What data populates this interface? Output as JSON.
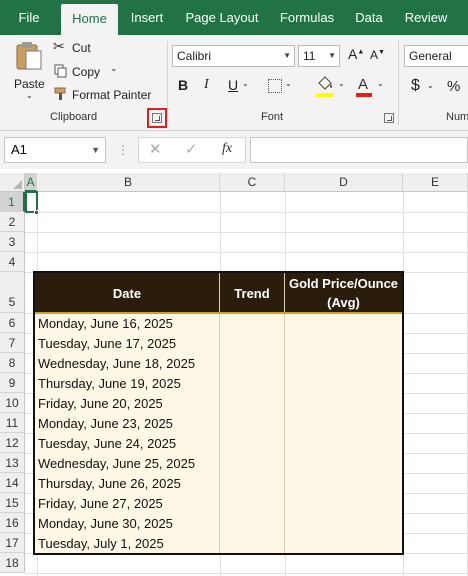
{
  "tabs": [
    "File",
    "Home",
    "Insert",
    "Page Layout",
    "Formulas",
    "Data",
    "Review"
  ],
  "clipboard": {
    "paste": "Paste",
    "cut": "Cut",
    "copy": "Copy",
    "format_painter": "Format Painter",
    "group_label": "Clipboard"
  },
  "font": {
    "name": "Calibri",
    "size": "11",
    "group_label": "Font"
  },
  "number": {
    "format": "General",
    "group_label": "Num"
  },
  "formula_bar": {
    "name_box": "A1",
    "fx": "fx",
    "formula": ""
  },
  "columns": [
    "A",
    "B",
    "C",
    "D",
    "E"
  ],
  "rows": [
    "1",
    "2",
    "3",
    "4",
    "5",
    "6",
    "7",
    "8",
    "9",
    "10",
    "11",
    "12",
    "13",
    "14",
    "15",
    "16",
    "17",
    "18"
  ],
  "table": {
    "headers": [
      "Date",
      "Trend",
      "Gold Price/Ounce",
      "(Avg)"
    ],
    "dates": [
      "Monday, June 16, 2025",
      "Tuesday, June 17, 2025",
      "Wednesday, June 18, 2025",
      "Thursday, June 19, 2025",
      "Friday, June 20, 2025",
      "Monday, June 23, 2025",
      "Tuesday, June 24, 2025",
      "Wednesday, June 25, 2025",
      "Thursday, June 26, 2025",
      "Friday, June 27, 2025",
      "Monday, June 30, 2025",
      "Tuesday, July 1, 2025"
    ]
  },
  "colors": {
    "ribbon_green": "#217346",
    "table_header": "#2b1d0b",
    "table_body": "#fff8e6",
    "highlight_red": "#e0201b"
  }
}
